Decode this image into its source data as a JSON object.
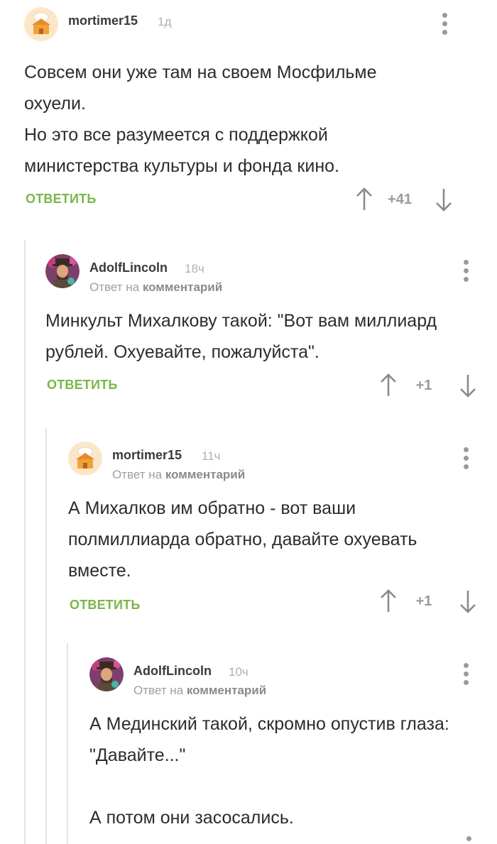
{
  "comments": [
    {
      "username": "mortimer15",
      "time": "1д",
      "avatar": "chef-house-avatar",
      "reply_to_prefix": "",
      "reply_to_link": "",
      "body": [
        "Совсем они уже там на своем Мосфильме охуели.",
        "Но это все разумеется с поддержкой министерства культуры и фонда кино."
      ],
      "reply_label": "ОТВЕТИТЬ",
      "score": "+41"
    },
    {
      "username": "AdolfLincoln",
      "time": "18ч",
      "avatar": "lincoln-portrait-avatar",
      "reply_to_prefix": "Ответ на",
      "reply_to_link": "комментарий",
      "body": [
        "Минкульт Михалкову такой: \"Вот вам миллиард рублей. Охуевайте, пожалуйста\"."
      ],
      "reply_label": "ОТВЕТИТЬ",
      "score": "+1"
    },
    {
      "username": "mortimer15",
      "time": "11ч",
      "avatar": "chef-house-avatar",
      "reply_to_prefix": "Ответ на",
      "reply_to_link": "комментарий",
      "body": [
        "А Михалков им обратно - вот ваши полмиллиарда обратно, давайте охуевать вместе."
      ],
      "reply_label": "ОТВЕТИТЬ",
      "score": "+1"
    },
    {
      "username": "AdolfLincoln",
      "time": "10ч",
      "avatar": "lincoln-portrait-avatar",
      "reply_to_prefix": "Ответ на",
      "reply_to_link": "комментарий",
      "body": [
        "А Мединский такой, скромно опустив глаза: \"Давайте...\"",
        "",
        "А потом они засосались."
      ],
      "reply_label": "",
      "score": ""
    }
  ],
  "colors": {
    "reply_green": "#7ab648",
    "thread_line": "#e4e4e4",
    "muted_text": "#9e9e9e"
  },
  "icons": [
    "kebab-menu-icon",
    "arrow-up-icon",
    "arrow-down-icon"
  ]
}
